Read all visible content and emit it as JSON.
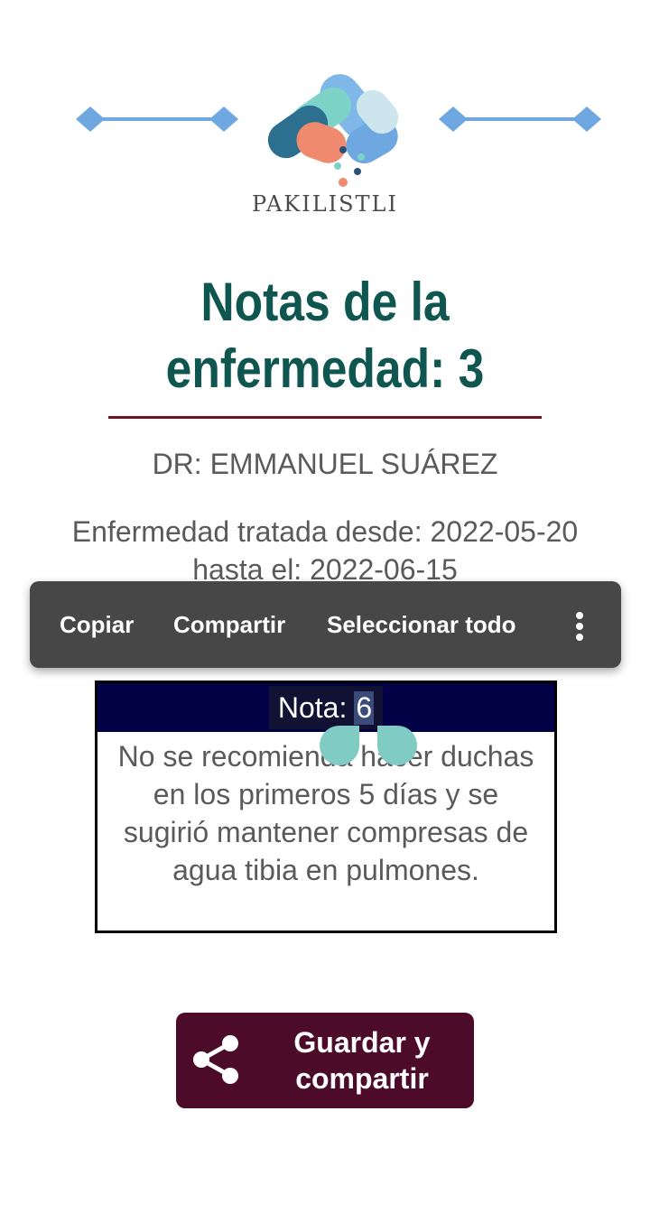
{
  "header": {
    "brand": "PAKILISTLI"
  },
  "page": {
    "title": "Notas de la enfermedad: 3",
    "doctor": "DR: EMMANUEL SUÁREZ",
    "period": "Enfermedad tratada desde: 2022-05-20 hasta el: 2022-06-15"
  },
  "note": {
    "label": "Nota:",
    "number": "6",
    "text": "No se recomienda hacer duchas en los primeros 5 días y se sugirió mantener compresas de agua tibia en pulmones."
  },
  "context_menu": {
    "items": [
      {
        "label": "Copiar"
      },
      {
        "label": "Compartir"
      },
      {
        "label": "Seleccionar todo"
      }
    ],
    "more_icon": "more-vert-icon"
  },
  "actions": {
    "save_share_label": "Guardar y compartir",
    "save_share_icon": "share-icon"
  },
  "colors": {
    "title": "#0f5650",
    "rule": "#6b1420",
    "note_header": "#040247",
    "menu_bg": "#474747",
    "button_bg": "#4d0b2a",
    "selection_handle": "#80cbc4"
  }
}
